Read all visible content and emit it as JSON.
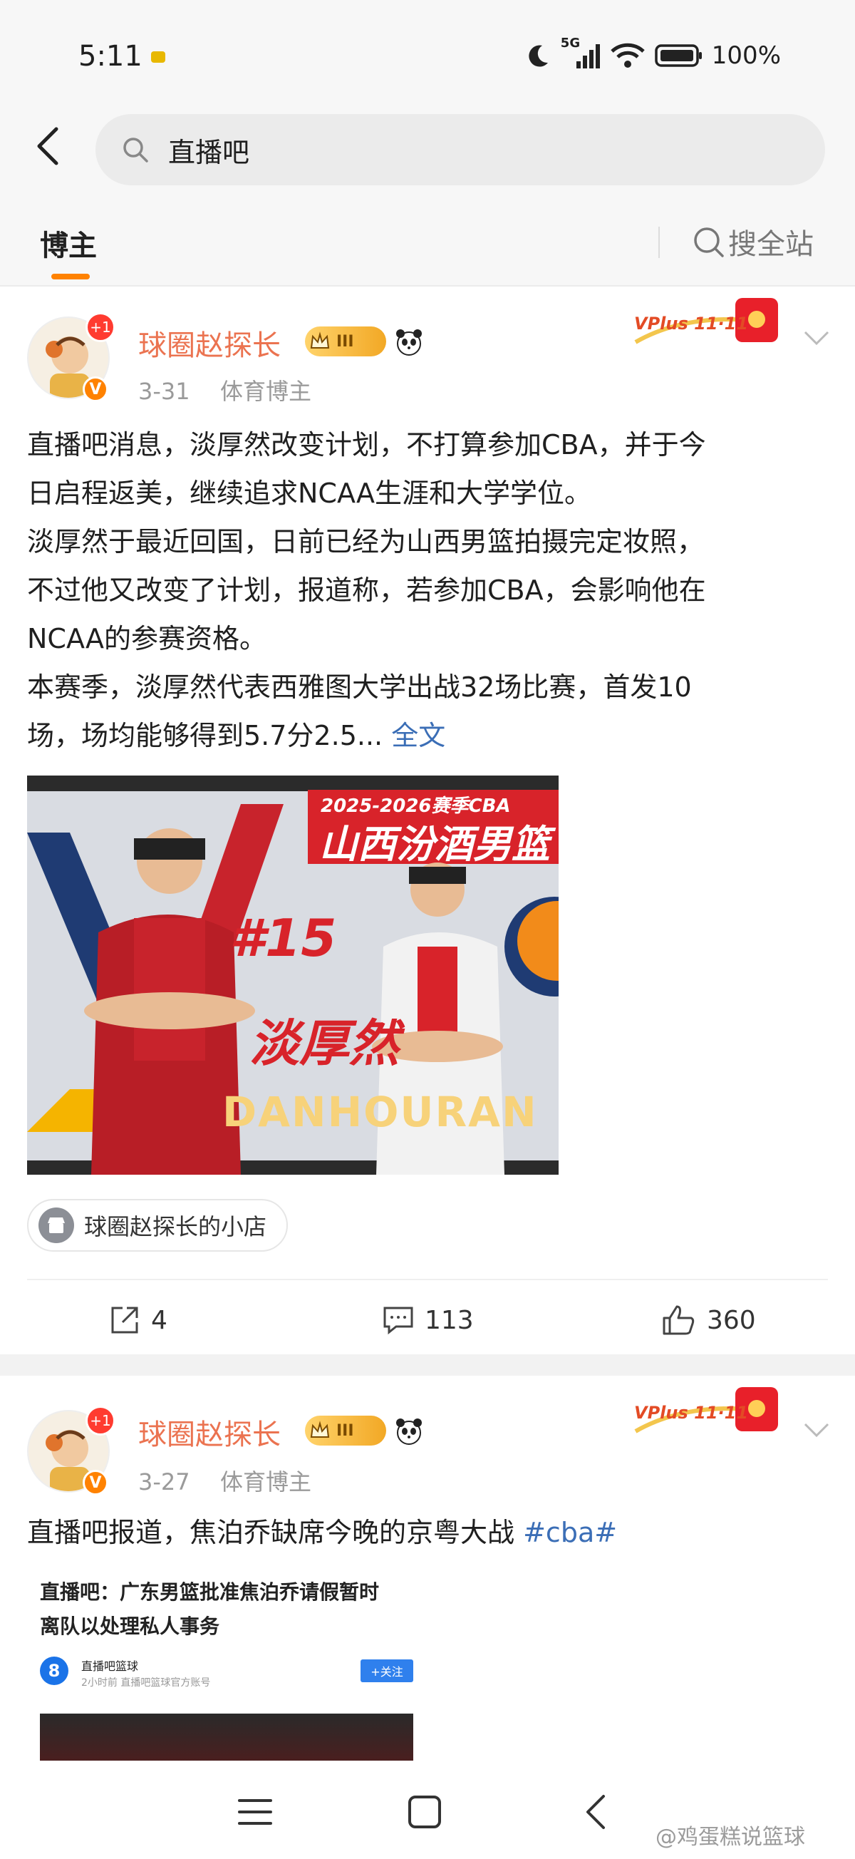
{
  "status_bar": {
    "time": "5:11",
    "network": "5G",
    "battery": "100%"
  },
  "search": {
    "query": "直播吧"
  },
  "tabs": {
    "active": "博主",
    "search_all": "搜全站"
  },
  "posts": [
    {
      "author": "球圈赵探长",
      "level_badge": "III",
      "plus_badge": "+1",
      "verified_badge": "V",
      "date": "3-31",
      "category": "体育博主",
      "promo": "VPlus 11·11",
      "text_lines": [
        "直播吧消息，淡厚然改变计划，不打算参加CBA，并于今",
        "日启程返美，继续追求NCAA生涯和大学学位。",
        "淡厚然于最近回国，日前已经为山西男篮拍摄完定妆照，",
        "不过他又改变了计划，报道称，若参加CBA，会影响他在",
        "NCAA的参赛资格。",
        "本赛季，淡厚然代表西雅图大学出战32场比赛，首发10",
        "场，场均能够得到5.7分2.5... "
      ],
      "full_text_link": "全文",
      "image": {
        "season_banner": "2025-2026赛季CBA",
        "team_banner": "山西汾酒男篮",
        "number": "#15",
        "player_cn": "淡厚然",
        "player_en": "DANHOURAN"
      },
      "shop_chip": "球圈赵探长的小店",
      "actions": {
        "share": "4",
        "comments": "113",
        "likes": "360"
      }
    },
    {
      "author": "球圈赵探长",
      "level_badge": "III",
      "plus_badge": "+1",
      "verified_badge": "V",
      "date": "3-27",
      "category": "体育博主",
      "promo": "VPlus 11·11",
      "text": "直播吧报道，焦泊乔缺席今晚的京粤大战 ",
      "hashtag": "#cba#",
      "embed": {
        "title_line1": "直播吧：广东男篮批准焦泊乔请假暂时",
        "title_line2": "离队以处理私人事务",
        "logo": "8",
        "source": "直播吧篮球",
        "sub": "2小时前  直播吧篮球官方账号",
        "follow": "+关注"
      }
    }
  ],
  "watermark": "@鸡蛋糕说篮球",
  "colors": {
    "accent_orange": "#ff8200",
    "author_name": "#eb7350",
    "link_blue": "#3b6eb6"
  }
}
